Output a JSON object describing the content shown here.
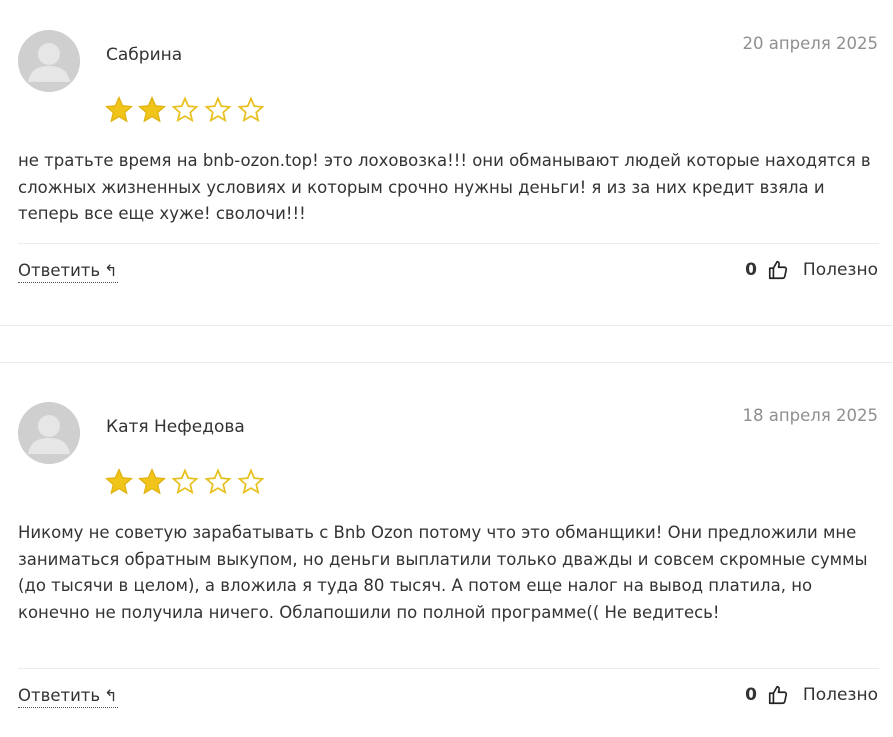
{
  "colors": {
    "star_filled": "#f0c419",
    "star_outline": "#e8c020",
    "avatar_bg": "#cfcfcf",
    "text": "#333333",
    "date": "#8f8f8f"
  },
  "reviews": [
    {
      "author": "Сабрина",
      "date": "20 апреля 2025",
      "rating": 2,
      "max_rating": 5,
      "text": "не тратьте время на bnb-ozon.top! это лоховозка!!! они обманывают людей которые находятся в сложных жизненных условиях и которым срочно нужны деньги! я из за них кредит взяла и теперь все еще хуже! сволочи!!!",
      "reply_label": "Ответить",
      "reply_icon": "reply-arrow-icon",
      "likes": "0",
      "useful_label": "Полезно"
    },
    {
      "author": "Катя Нефедова",
      "date": "18 апреля 2025",
      "rating": 2,
      "max_rating": 5,
      "text": "Никому не советую зарабатывать с Bnb Ozon потому что это обманщики! Они предложили мне заниматься обратным выкупом, но деньги выплатили только дважды и совсем скромные суммы (до тысячи в целом), а вложила я туда 80 тысяч. А потом еще налог на вывод платила, но конечно не получила ничего. Облапошили по полной программе(( Не ведитесь!",
      "reply_label": "Ответить",
      "reply_icon": "reply-arrow-icon",
      "likes": "0",
      "useful_label": "Полезно"
    }
  ]
}
